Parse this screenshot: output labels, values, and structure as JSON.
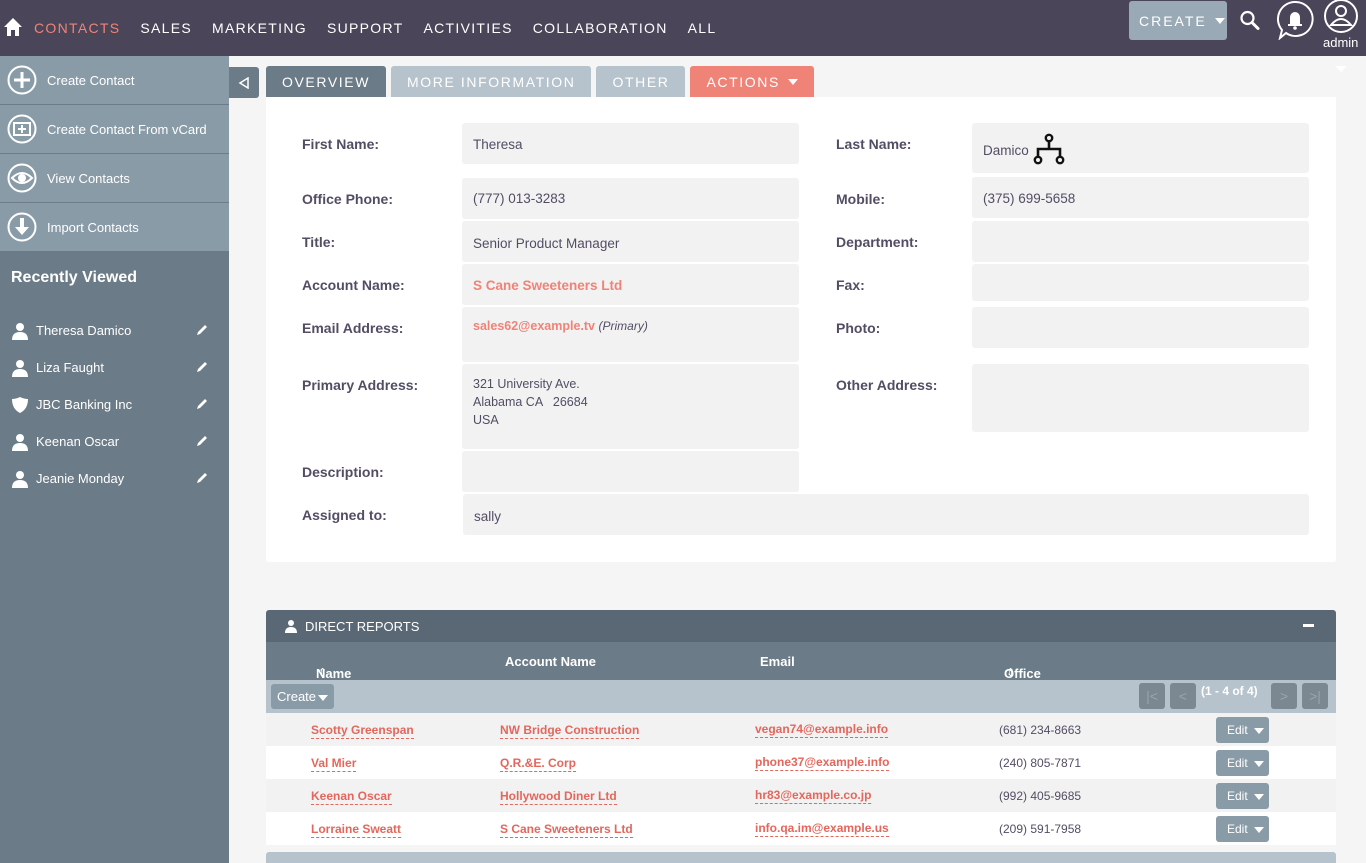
{
  "nav": {
    "items": [
      "CONTACTS",
      "SALES",
      "MARKETING",
      "SUPPORT",
      "ACTIVITIES",
      "COLLABORATION",
      "ALL"
    ],
    "active": "CONTACTS",
    "create_label": "CREATE",
    "user_label": "admin"
  },
  "sidebar": {
    "actions": [
      {
        "label": "Create Contact",
        "icon": "plus-circle-icon"
      },
      {
        "label": "Create Contact From vCard",
        "icon": "vcard-icon"
      },
      {
        "label": "View Contacts",
        "icon": "eye-icon"
      },
      {
        "label": "Import Contacts",
        "icon": "download-icon"
      }
    ],
    "recently_viewed_title": "Recently Viewed",
    "recently_viewed": [
      {
        "label": "Theresa Damico",
        "icon": "person-icon"
      },
      {
        "label": "Liza Faught",
        "icon": "person-icon"
      },
      {
        "label": "JBC Banking Inc",
        "icon": "shield-icon"
      },
      {
        "label": "Keenan Oscar",
        "icon": "person-icon"
      },
      {
        "label": "Jeanie Monday",
        "icon": "person-icon"
      }
    ]
  },
  "tabs": {
    "overview": "OVERVIEW",
    "more_info": "MORE INFORMATION",
    "other": "OTHER",
    "actions": "ACTIONS"
  },
  "contact": {
    "first_name_label": "First Name:",
    "first_name": "Theresa",
    "last_name_label": "Last Name:",
    "last_name": "Damico",
    "office_phone_label": "Office Phone:",
    "office_phone": "(777) 013-3283",
    "mobile_label": "Mobile:",
    "mobile": "(375) 699-5658",
    "title_label": "Title:",
    "title": "Senior Product Manager",
    "department_label": "Department:",
    "department": "",
    "account_name_label": "Account Name:",
    "account_name": "S Cane Sweeteners Ltd",
    "fax_label": "Fax:",
    "fax": "",
    "email_label": "Email Address:",
    "email": "sales62@example.tv",
    "email_tag": "(Primary)",
    "photo_label": "Photo:",
    "primary_address_label": "Primary Address:",
    "primary_address": [
      "321 University Ave.",
      "Alabama CA   26684",
      "USA"
    ],
    "other_address_label": "Other Address:",
    "description_label": "Description:",
    "description": "",
    "assigned_label": "Assigned to:",
    "assigned": "sally"
  },
  "direct_reports": {
    "title": "DIRECT REPORTS",
    "columns": [
      "Name",
      "Account Name",
      "Email",
      "Office Phone"
    ],
    "create_label": "Create",
    "pagination": "(1 - 4 of 4)",
    "edit_label": "Edit",
    "rows": [
      {
        "name": "Scotty Greenspan",
        "account": "NW Bridge Construction",
        "email": "vegan74@example.info",
        "phone": "(681) 234-8663"
      },
      {
        "name": "Val Mier",
        "account": "Q.R.&E. Corp",
        "email": "phone37@example.info",
        "phone": "(240) 805-7871"
      },
      {
        "name": "Keenan Oscar",
        "account": "Hollywood Diner Ltd",
        "email": "hr83@example.co.jp",
        "phone": "(992) 405-9685"
      },
      {
        "name": "Lorraine Sweatt",
        "account": "S Cane Sweeteners Ltd",
        "email": "info.qa.im@example.us",
        "phone": "(209) 591-7958"
      }
    ]
  },
  "colors": {
    "accent": "#f08377",
    "nav_bg": "#4a4559",
    "sidebar_bg": "#6b7b87"
  }
}
